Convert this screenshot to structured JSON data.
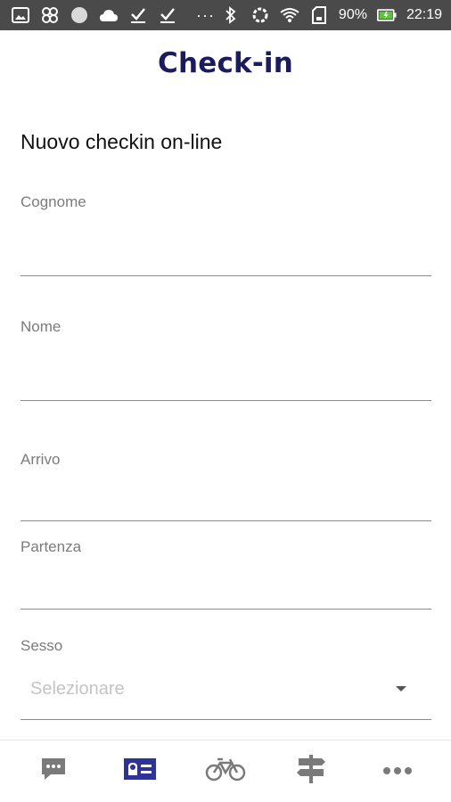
{
  "status_bar": {
    "left_icons": [
      "gallery-icon",
      "pinwheel-icon",
      "circle-icon",
      "cloud-icon",
      "download-check-icon",
      "download-check-icon"
    ],
    "more": "···",
    "battery_percent": "90%",
    "time": "22:19",
    "right_icons": [
      "bluetooth-icon",
      "sync-icon",
      "wifi-icon",
      "sim-card-icon",
      "battery-charging-icon"
    ]
  },
  "header": {
    "title": "Check-in"
  },
  "form": {
    "section_title": "Nuovo checkin on-line",
    "fields": [
      {
        "label": "Cognome",
        "value": ""
      },
      {
        "label": "Nome",
        "value": ""
      },
      {
        "label": "Arrivo",
        "value": ""
      },
      {
        "label": "Partenza",
        "value": ""
      }
    ],
    "sex": {
      "label": "Sesso",
      "selected": "Selezionare"
    }
  },
  "bottom_nav": {
    "items": [
      {
        "icon": "chat-icon",
        "active": false
      },
      {
        "icon": "id-card-icon",
        "active": true
      },
      {
        "icon": "bicycle-icon",
        "active": false
      },
      {
        "icon": "signpost-icon",
        "active": false
      },
      {
        "icon": "more-icon",
        "active": false
      }
    ]
  },
  "colors": {
    "status_bar": "#4a4a4a",
    "title": "#1b1b5e",
    "nav_active": "#2f3296",
    "nav_inactive": "#7a7a7a",
    "field_label": "#7b7b7b",
    "placeholder": "#c4c4c4"
  }
}
